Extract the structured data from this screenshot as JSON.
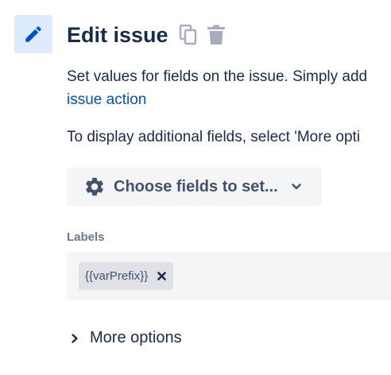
{
  "header": {
    "title": "Edit issue",
    "icons": [
      "pencil-icon",
      "copy-icon",
      "trash-icon"
    ]
  },
  "description": {
    "line1": "Set values for fields on the issue. Simply add",
    "link": "issue action",
    "line2": "To display additional fields, select 'More opti"
  },
  "choose_fields": {
    "label": "Choose fields to set...",
    "icon": "gear-icon",
    "dropdown_icon": "chevron-down-icon"
  },
  "labels_field": {
    "label": "Labels",
    "tags": [
      {
        "text": "{{varPrefix}}"
      }
    ]
  },
  "more_options": {
    "label": "More options"
  },
  "colors": {
    "accent": "#0052CC",
    "tile_background": "#DEEBFF",
    "field_background": "#F4F5F7",
    "text_primary": "#172B4D",
    "text_secondary": "#6B778C"
  }
}
